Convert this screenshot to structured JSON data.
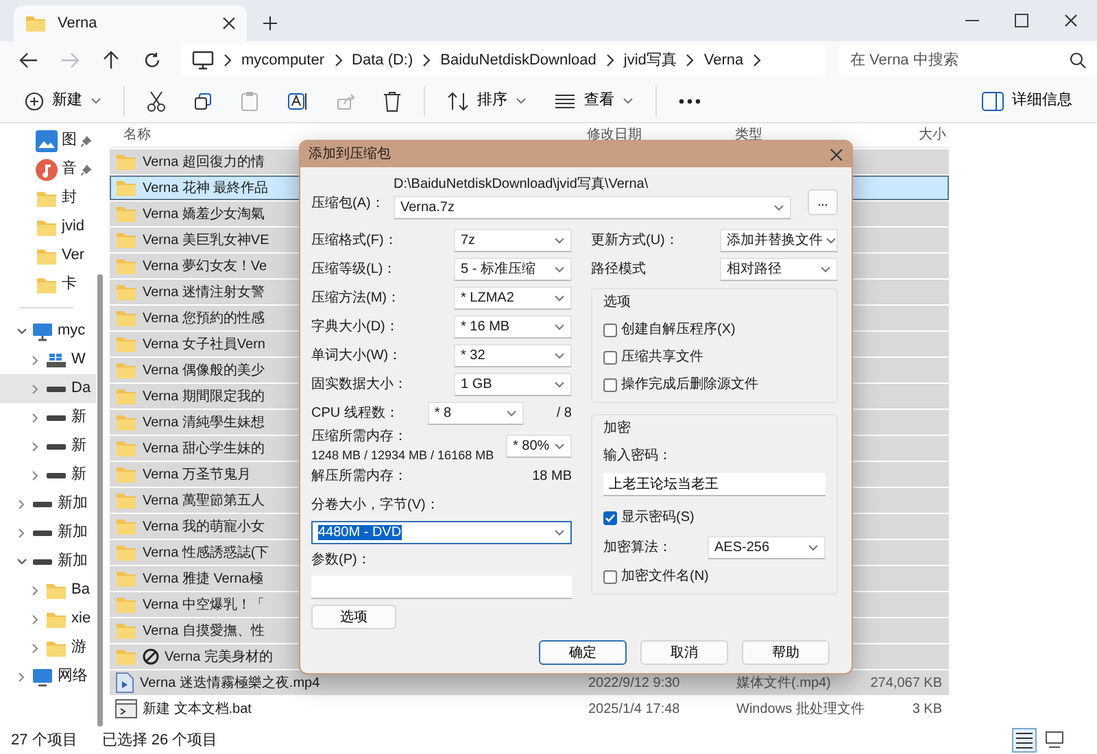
{
  "window": {
    "tab_title": "Verna"
  },
  "address_bar": {
    "nav_buttons": [
      {
        "kind": "back",
        "disabled": false
      },
      {
        "kind": "forward",
        "disabled": true
      },
      {
        "kind": "up",
        "disabled": false
      },
      {
        "kind": "refresh",
        "disabled": false
      }
    ],
    "path": [
      "mycomputer",
      "Data (D:)",
      "BaiduNetdiskDownload",
      "jvid写真",
      "Verna"
    ],
    "search_placeholder": "在 Verna 中搜索"
  },
  "toolbar": {
    "items": [
      {
        "kind": "new",
        "label": "新建",
        "disabled": false
      },
      {
        "kind": "cut",
        "disabled": false
      },
      {
        "kind": "copy",
        "disabled": false
      },
      {
        "kind": "paste",
        "disabled": true
      },
      {
        "kind": "rename",
        "disabled": false
      },
      {
        "kind": "share",
        "disabled": true
      },
      {
        "kind": "delete",
        "disabled": false
      },
      {
        "kind": "sort",
        "label": "排序",
        "disabled": false
      },
      {
        "kind": "view",
        "label": "查看",
        "disabled": false
      },
      {
        "kind": "more",
        "disabled": false
      }
    ],
    "details_label": "详细信息"
  },
  "nav_pane": {
    "quick_access": [
      {
        "kind": "pictures",
        "label": "图",
        "pinned": true
      },
      {
        "kind": "music",
        "label": "音",
        "pinned": true
      },
      {
        "kind": "folder",
        "label": "封",
        "pinned": false
      },
      {
        "kind": "folder",
        "label": "jvid",
        "pinned": false
      },
      {
        "kind": "folder",
        "label": "Ver",
        "pinned": false
      },
      {
        "kind": "folder",
        "label": "卡",
        "pinned": false
      }
    ],
    "tree": [
      {
        "kind": "computer",
        "label": "myc",
        "expanded": true,
        "selected": false,
        "children": [
          {
            "kind": "windows_drive",
            "label": "W",
            "expanded": false,
            "selected": false
          },
          {
            "kind": "drive",
            "label": "Da",
            "expanded": false,
            "selected": true
          },
          {
            "kind": "drive",
            "label": "新",
            "expanded": false,
            "selected": false
          },
          {
            "kind": "drive",
            "label": "新",
            "expanded": false,
            "selected": false
          },
          {
            "kind": "drive",
            "label": "新",
            "expanded": false,
            "selected": false
          }
        ]
      },
      {
        "kind": "drive",
        "label": "新加",
        "expanded": false,
        "selected": false
      },
      {
        "kind": "drive",
        "label": "新加",
        "expanded": false,
        "selected": false
      },
      {
        "kind": "drive",
        "label": "新加",
        "expanded": true,
        "selected": false,
        "children": [
          {
            "kind": "folder",
            "label": "Ba",
            "expanded": false,
            "selected": false
          },
          {
            "kind": "folder",
            "label": "xie",
            "expanded": false,
            "selected": false
          },
          {
            "kind": "folder",
            "label": "游",
            "expanded": false,
            "selected": false
          }
        ]
      },
      {
        "kind": "network",
        "label": "网络",
        "expanded": false,
        "selected": false
      }
    ]
  },
  "file_list": {
    "columns": [
      "名称",
      "修改日期",
      "类型",
      "大小"
    ],
    "rows": [
      {
        "kind": "folder",
        "name": "Verna 超回復力的情",
        "selected": true,
        "focused": false
      },
      {
        "kind": "folder",
        "name": "Verna 花神 最終作品",
        "selected": true,
        "focused": true
      },
      {
        "kind": "folder",
        "name": "Verna 嬌羞少女淘氣",
        "selected": true,
        "focused": false
      },
      {
        "kind": "folder",
        "name": "Verna 美巨乳女神VE",
        "selected": true,
        "focused": false
      },
      {
        "kind": "folder",
        "name": "Verna 夢幻女友！Ve",
        "selected": true,
        "focused": false
      },
      {
        "kind": "folder",
        "name": "Verna 迷情注射女警",
        "selected": true,
        "focused": false
      },
      {
        "kind": "folder",
        "name": "Verna 您預約的性感",
        "selected": true,
        "focused": false
      },
      {
        "kind": "folder",
        "name": "Verna 女子社員Vern",
        "selected": true,
        "focused": false
      },
      {
        "kind": "folder",
        "name": "Verna 偶像般的美少",
        "selected": true,
        "focused": false
      },
      {
        "kind": "folder",
        "name": "Verna 期間限定我的",
        "selected": true,
        "focused": false
      },
      {
        "kind": "folder",
        "name": "Verna 清純學生妹想",
        "selected": true,
        "focused": false
      },
      {
        "kind": "folder",
        "name": "Verna 甜心学生妹的",
        "selected": true,
        "focused": false
      },
      {
        "kind": "folder",
        "name": "Verna 万圣节鬼月",
        "selected": true,
        "focused": false
      },
      {
        "kind": "folder",
        "name": "Verna 萬聖節第五人",
        "selected": true,
        "focused": false
      },
      {
        "kind": "folder",
        "name": "Verna 我的萌寵小女",
        "selected": true,
        "focused": false
      },
      {
        "kind": "folder",
        "name": "Verna 性感誘惑誌(下",
        "selected": true,
        "focused": false
      },
      {
        "kind": "folder",
        "name": "Verna 雅捷 Verna極",
        "selected": true,
        "focused": false
      },
      {
        "kind": "folder",
        "name": "Verna 中空爆乳！「",
        "selected": true,
        "focused": false
      },
      {
        "kind": "folder",
        "name": "Verna 自摸愛撫、性",
        "selected": true,
        "focused": false
      },
      {
        "kind": "blocked_folder",
        "name": "Verna 完美身材的",
        "selected": true,
        "focused": false
      },
      {
        "kind": "video",
        "name": "Verna 迷迭情霧極樂之夜.mp4",
        "date": "2022/9/12 9:30",
        "type": "媒体文件(.mp4)",
        "size": "274,067 KB",
        "selected": true,
        "focused": false
      },
      {
        "kind": "batch",
        "name": "新建 文本文档.bat",
        "date": "2025/1/4 17:48",
        "type": "Windows 批处理文件",
        "size": "3 KB",
        "selected": false,
        "focused": false
      }
    ]
  },
  "status_bar": {
    "count": "27 个项目",
    "selection": "已选择 26 个项目",
    "view_buttons": [
      {
        "kind": "details",
        "selected": true
      },
      {
        "kind": "tiles",
        "selected": false
      }
    ]
  },
  "dialog": {
    "title": "添加到压缩包",
    "archive_label": "压缩包(A)：",
    "archive_dir": "D:\\BaiduNetdiskDownload\\jvid写真\\Verna\\",
    "archive_name": "Verna.7z",
    "browse_label": "...",
    "left_fields": [
      {
        "kind": "select",
        "label": "压缩格式(F)：",
        "value": "7z"
      },
      {
        "kind": "select",
        "label": "压缩等级(L)：",
        "value": "5 - 标准压缩"
      },
      {
        "kind": "select",
        "label": "压缩方法(M)：",
        "value": "* LZMA2"
      },
      {
        "kind": "select",
        "label": "字典大小(D)：",
        "value": "* 16 MB"
      },
      {
        "kind": "select",
        "label": "单词大小(W)：",
        "value": "* 32"
      },
      {
        "kind": "select",
        "label": "固实数据大小：",
        "value": "1 GB"
      },
      {
        "kind": "select_suffix",
        "label": "CPU 线程数：",
        "value": "* 8",
        "suffix": "/ 8"
      },
      {
        "kind": "memory",
        "label": "压缩所需内存：",
        "detail": "1248 MB / 12934 MB / 16168 MB",
        "value": "* 80%"
      },
      {
        "kind": "reading",
        "label": "解压所需内存：",
        "value": "18 MB"
      },
      {
        "kind": "wide_select",
        "label": "分卷大小，字节(V)：",
        "value": "4480M - DVD"
      },
      {
        "kind": "text",
        "label": "参数(P)："
      }
    ],
    "options_button": "选项",
    "update_label": "更新方式(U)：",
    "update_value": "添加并替换文件",
    "path_mode_label": "路径模式",
    "path_mode_value": "相对路径",
    "options_group": {
      "title": "选项",
      "checkboxes": [
        {
          "label": "创建自解压程序(X)",
          "checked": false
        },
        {
          "label": "压缩共享文件",
          "checked": false
        },
        {
          "label": "操作完成后删除源文件",
          "checked": false
        }
      ]
    },
    "encryption_group": {
      "title": "加密",
      "password_label": "输入密码：",
      "password": "上老王论坛当老王",
      "show_password": {
        "label": "显示密码(S)",
        "checked": true
      },
      "method_label": "加密算法：",
      "method_value": "AES-256",
      "encrypt_names": {
        "label": "加密文件名(N)",
        "checked": false
      }
    },
    "buttons": [
      {
        "label": "确定",
        "default": true
      },
      {
        "label": "取消",
        "default": false
      },
      {
        "label": "帮助",
        "default": false
      }
    ]
  }
}
